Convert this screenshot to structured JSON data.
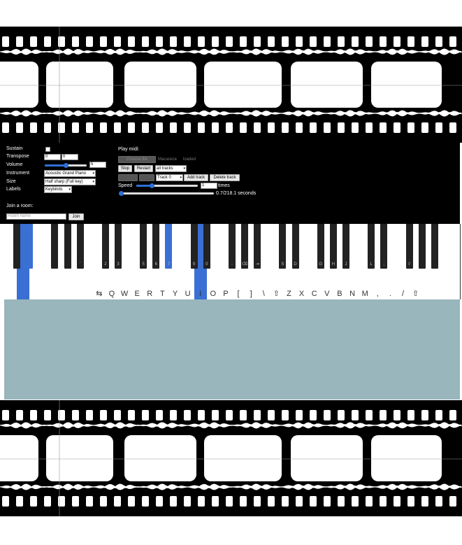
{
  "controls": {
    "sustain_label": "Sustain",
    "sustain_checked": false,
    "transpose_label": "Transpose",
    "transpose_a": "0",
    "transpose_b": "0",
    "volume_label": "Volume",
    "volume_value": "5",
    "volume_level": 0.5,
    "instrument_label": "Instrument",
    "instrument_value": "Acoustic Grand Piano",
    "size_label": "Size",
    "size_value": "Half sharp (Full key)",
    "labels_label": "Labels",
    "labels_value": "Keybinds",
    "join_room_label": "Join a room:",
    "room_name_placeholder": "Room name",
    "join_button": "Join"
  },
  "midi": {
    "play_midi_label": "Play midi:",
    "choose_file_button": "Choose file",
    "file_name": "Macarena",
    "status": "loaded",
    "stop_button": "Stop",
    "restart_button": "Restart",
    "tracks_select": "all tracks",
    "track_select": "Track 0",
    "add_track_button": "Add track",
    "delete_track_button": "Delete track",
    "speed_label": "Speed",
    "speed_value": "1",
    "speed_unit": "times",
    "speed_level": 0.25,
    "progress_text": "0.7/218.1 seconds",
    "progress_level": 0.01
  },
  "piano": {
    "white_labels": [
      "",
      "",
      "",
      "",
      "",
      "",
      "",
      "⇆",
      "Q",
      "W",
      "E",
      "R",
      "T",
      "Y",
      "U",
      "I",
      "O",
      "P",
      "[",
      "]",
      "\\",
      "⇧",
      "Z",
      "X",
      "C",
      "V",
      "B",
      "N",
      "M",
      ",",
      ".",
      "/",
      "⇧",
      "",
      "",
      ""
    ],
    "black_labels": [
      "",
      "",
      "",
      "",
      "`",
      "2",
      "3",
      "5",
      "6",
      "7",
      "9",
      "0",
      "-",
      "⌫",
      "⇥",
      "S",
      "D",
      "G",
      "H",
      "J",
      "L",
      ";",
      "⇧",
      "",
      ""
    ],
    "highlight_white": [
      1,
      15
    ],
    "highlight_black": [
      1,
      9
    ]
  }
}
